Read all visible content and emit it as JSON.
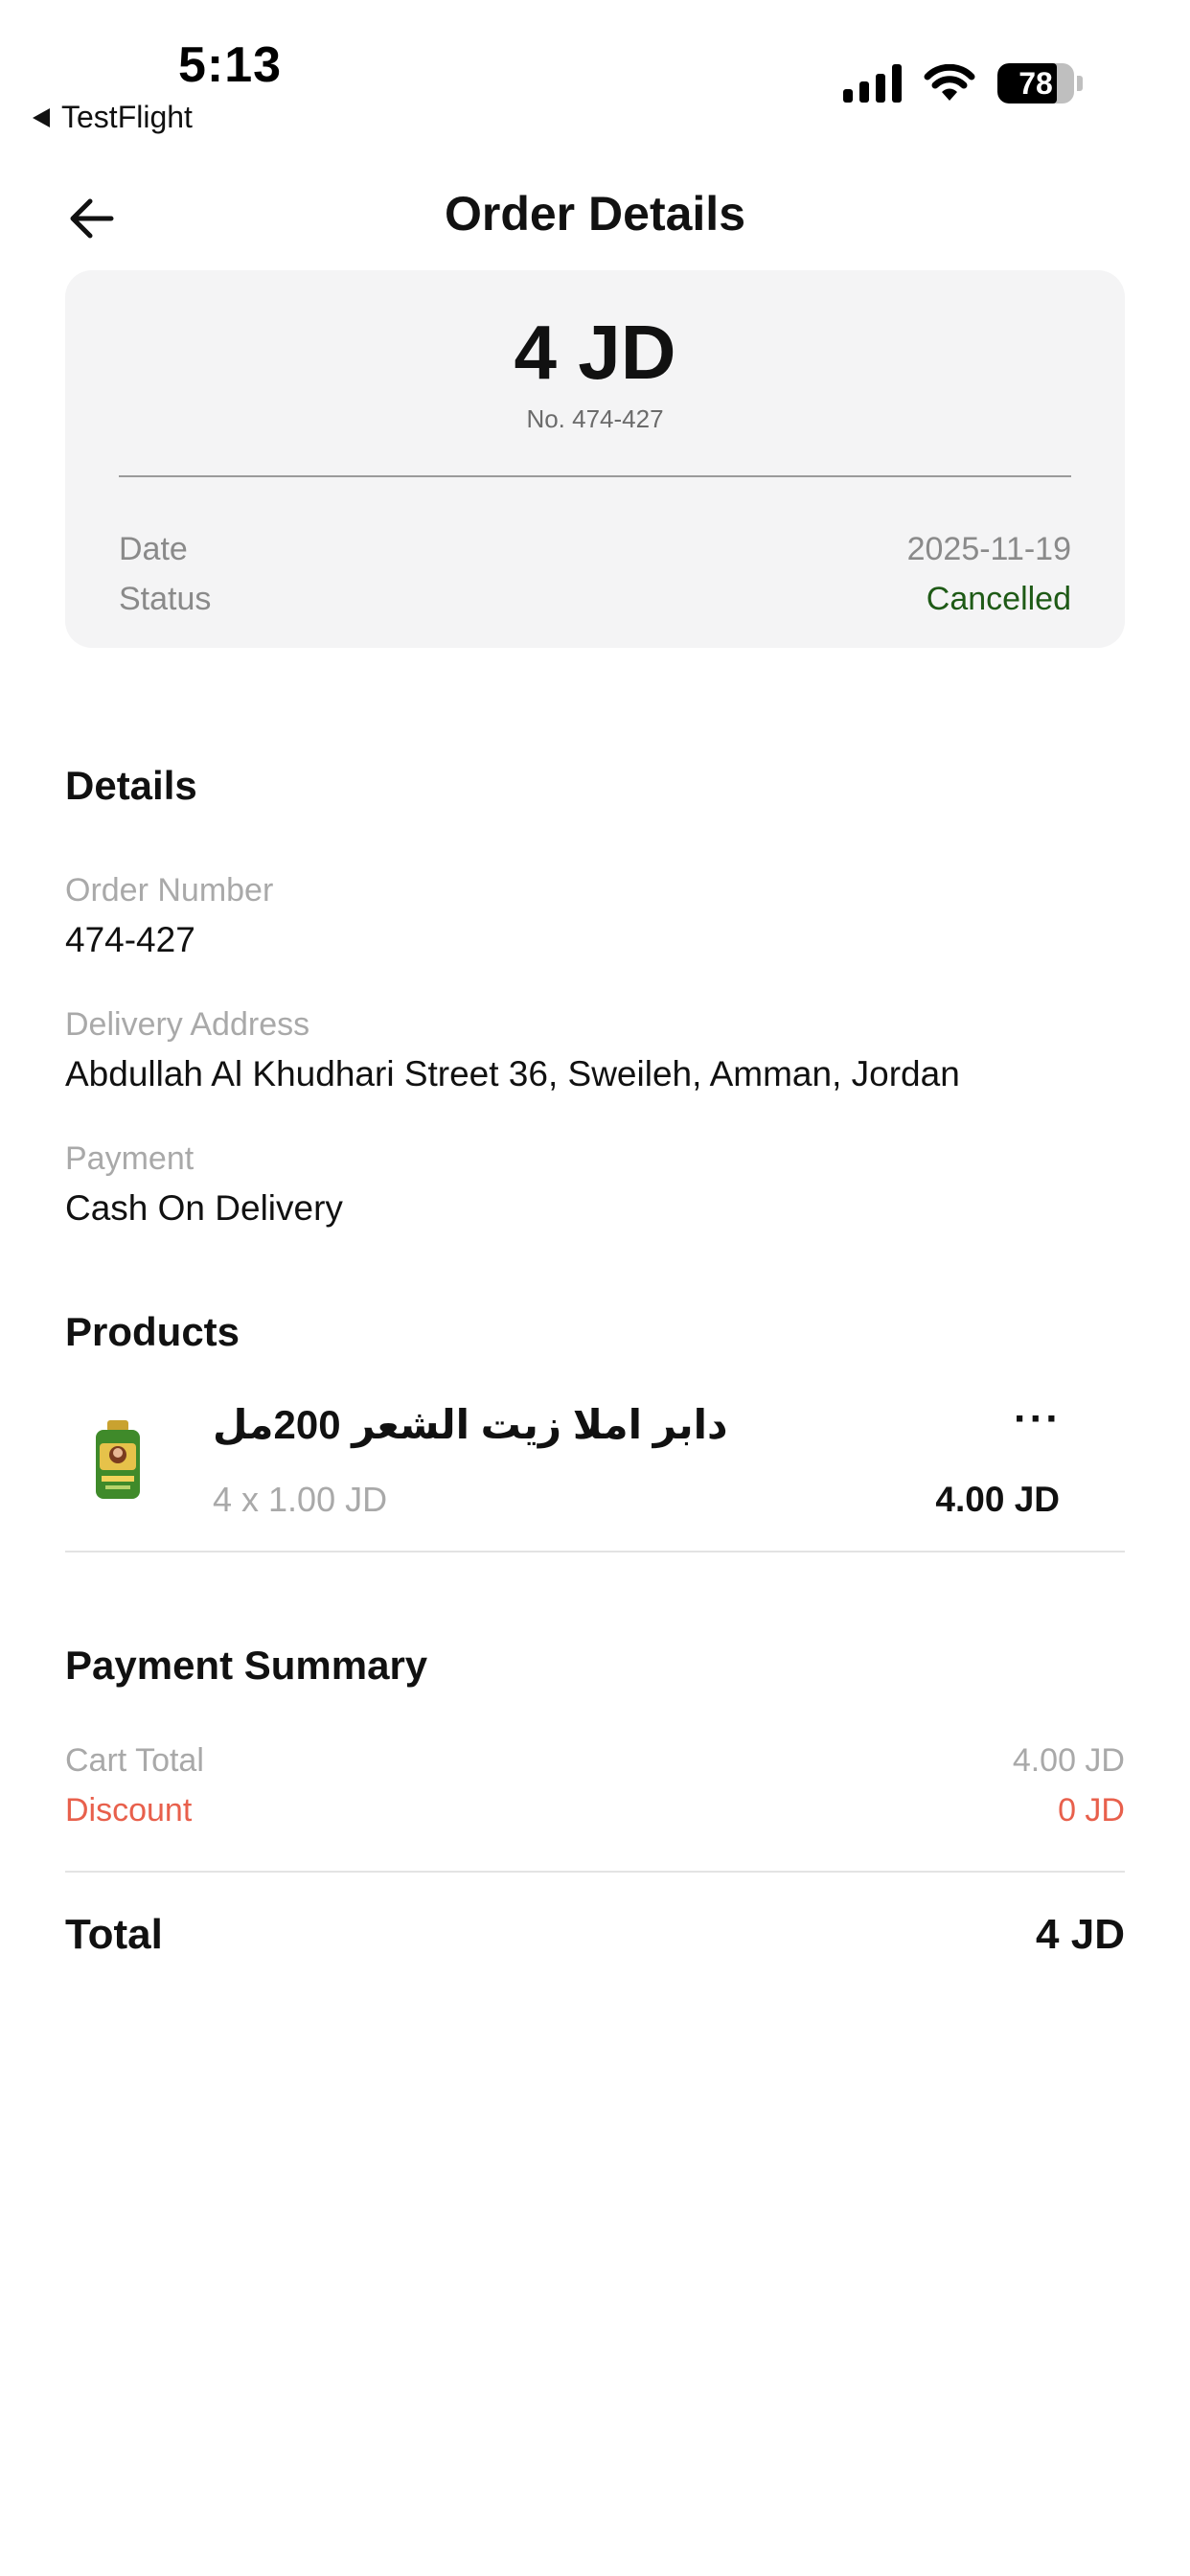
{
  "status_bar": {
    "time": "5:13",
    "back_app": "TestFlight",
    "battery": 78
  },
  "header": {
    "back_icon": "arrow-left-icon",
    "title": "Order Details"
  },
  "summary_card": {
    "amount": "4 JD",
    "order_no": "No. 474-427",
    "date_label": "Date",
    "date_value": "2025-11-19",
    "status_label": "Status",
    "status_value": "Cancelled",
    "status_color": "#1e5a16"
  },
  "details": {
    "title": "Details",
    "order_number_label": "Order Number",
    "order_number_value": "474-427",
    "address_label": "Delivery Address",
    "address_value": "Abdullah Al Khudhari Street 36, Sweileh, Amman, Jordan",
    "payment_label": "Payment",
    "payment_value": "Cash On Delivery"
  },
  "products": {
    "title": "Products",
    "items": [
      {
        "name": "دابر املا زيت الشعر 200مل",
        "qty_price": "4 x 1.00 JD",
        "total": "4.00 JD",
        "more_icon": "more-horizontal-icon"
      }
    ]
  },
  "payment_summary": {
    "title": "Payment Summary",
    "cart_total_label": "Cart Total",
    "cart_total_value": "4.00 JD",
    "discount_label": "Discount",
    "discount_value": "0 JD",
    "discount_color": "#e8604c",
    "total_label": "Total",
    "total_value": "4 JD"
  }
}
